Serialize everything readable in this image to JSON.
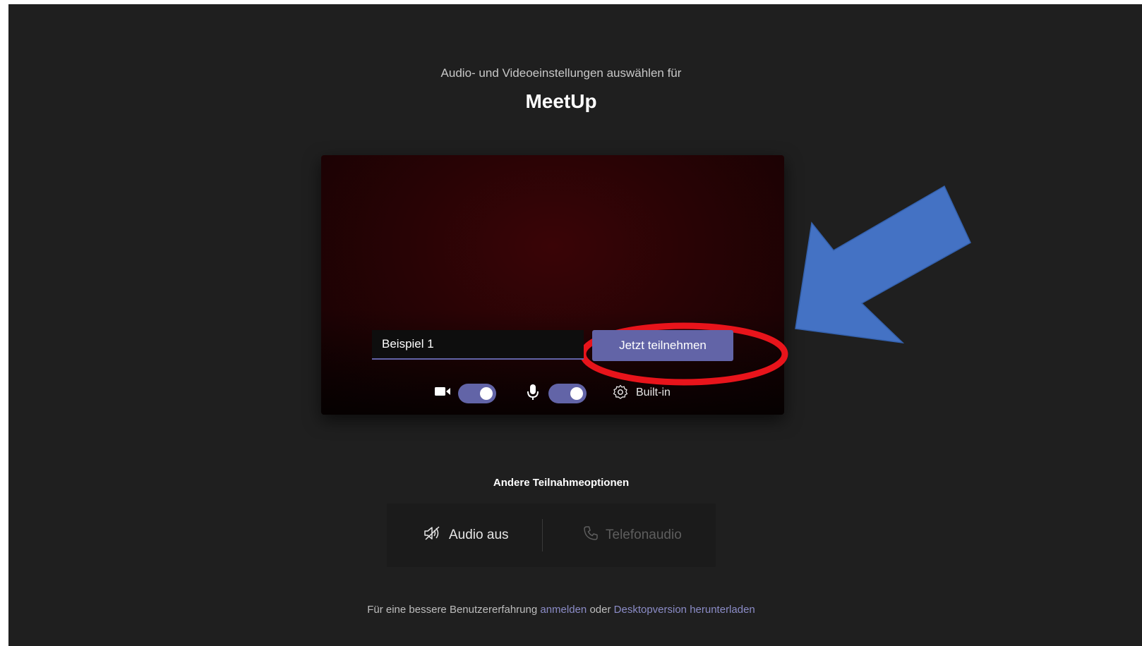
{
  "header": {
    "subtitle": "Audio- und Videoeinstellungen auswählen für",
    "meeting_name": "MeetUp"
  },
  "preview": {
    "name_input_value": "Beispiel 1",
    "join_button_label": "Jetzt teilnehmen",
    "camera_toggle_on": true,
    "mic_toggle_on": true,
    "device_label": "Built-in"
  },
  "other_options": {
    "title": "Andere Teilnahmeoptionen",
    "audio_off_label": "Audio aus",
    "phone_audio_label": "Telefonaudio"
  },
  "footer": {
    "prefix": "Für eine bessere Benutzererfahrung",
    "signin_link": "anmelden",
    "middle": "oder",
    "download_link": "Desktopversion herunterladen"
  },
  "colors": {
    "background": "#1f1f1f",
    "accent": "#6264a7",
    "annotation_circle": "#e8141b",
    "annotation_arrow": "#4472c4"
  },
  "icons": [
    "camera-icon",
    "microphone-icon",
    "settings-gear-icon",
    "speaker-off-icon",
    "phone-icon"
  ]
}
